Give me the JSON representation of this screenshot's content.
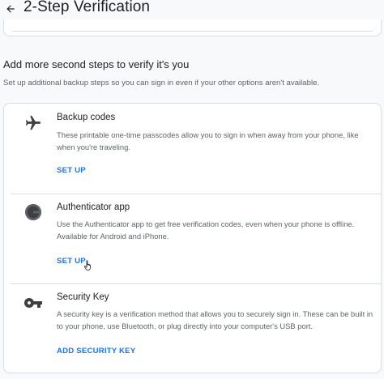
{
  "header": {
    "title": "2-Step Verification",
    "back_icon": "arrow-back-icon"
  },
  "section": {
    "title": "Add more second steps to verify it's you",
    "description": "Set up additional backup steps so you can sign in even if your other options aren't available."
  },
  "options": [
    {
      "icon": "airplane-icon",
      "title": "Backup codes",
      "description": "These printable one-time passcodes allow you to sign in when away from your phone, like when you're traveling.",
      "action": "SET UP"
    },
    {
      "icon": "authenticator-icon",
      "title": "Authenticator app",
      "description": "Use the Authenticator app to get free verification codes, even when your phone is offline. Available for Android and iPhone.",
      "action": "SET UP"
    },
    {
      "icon": "key-icon",
      "title": "Security Key",
      "description": "A security key is a verification method that allows you to securely sign in. These can be built in to your phone, use Bluetooth, or plug directly into your computer's USB port.",
      "action": "ADD SECURITY KEY"
    }
  ],
  "colors": {
    "link": "#1a73e8",
    "text_primary": "#202124",
    "text_secondary": "#5f6368",
    "border": "#dadce0"
  }
}
